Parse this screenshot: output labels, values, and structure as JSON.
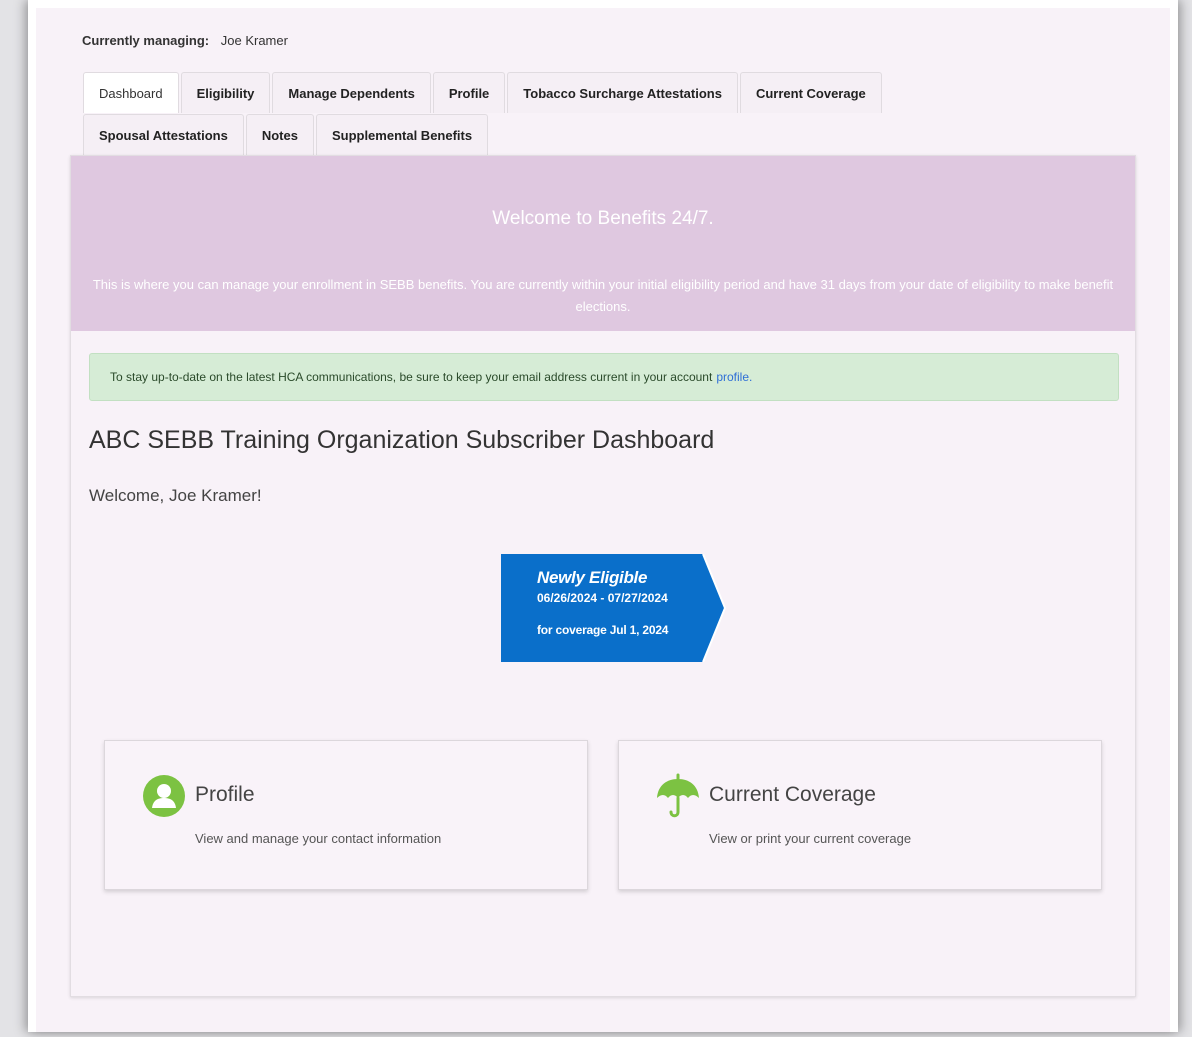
{
  "managing": {
    "label": "Currently managing:",
    "name": "Joe Kramer"
  },
  "tabs": [
    {
      "label": "Dashboard",
      "active": true
    },
    {
      "label": "Eligibility"
    },
    {
      "label": "Manage Dependents"
    },
    {
      "label": "Profile"
    },
    {
      "label": "Tobacco Surcharge Attestations"
    },
    {
      "label": "Current Coverage"
    },
    {
      "label": "Spousal Attestations"
    },
    {
      "label": "Notes"
    },
    {
      "label": "Supplemental Benefits"
    }
  ],
  "banner": {
    "title": "Welcome to Benefits 24/7.",
    "text": "This is where you can manage your enrollment in SEBB benefits. You are currently within your initial eligibility period and have 31 days from your date of eligibility to make benefit elections."
  },
  "alert": {
    "text": "To stay up-to-date on the latest HCA communications, be sure to keep your email address current in your account",
    "link": "profile."
  },
  "dashboard": {
    "title": "ABC SEBB Training Organization Subscriber Dashboard",
    "welcome": "Welcome, Joe Kramer!"
  },
  "badge": {
    "title": "Newly Eligible",
    "dates": "06/26/2024 - 07/27/2024",
    "coverage": "for coverage Jul 1, 2024",
    "color": "#0a6fca"
  },
  "cards": [
    {
      "title": "Profile",
      "subtitle": "View and manage your contact information",
      "icon": "user-icon"
    },
    {
      "title": "Current Coverage",
      "subtitle": "View or print your current coverage",
      "icon": "umbrella-icon"
    }
  ],
  "colors": {
    "accent_green": "#7cc242",
    "banner": "#dfc8e0",
    "alert": "#d6ecd6"
  }
}
